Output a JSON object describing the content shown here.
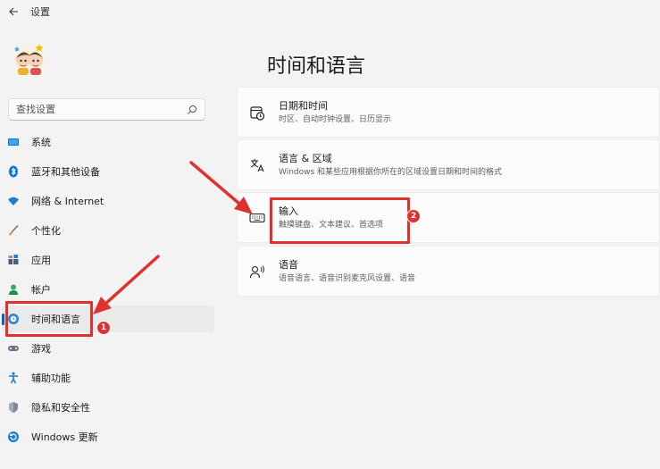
{
  "window": {
    "title": "设置"
  },
  "search": {
    "placeholder": "查找设置"
  },
  "sidebar": {
    "items": [
      {
        "label": "系统",
        "icon": "monitor-icon"
      },
      {
        "label": "蓝牙和其他设备",
        "icon": "bluetooth-icon"
      },
      {
        "label": "网络 & Internet",
        "icon": "wifi-icon"
      },
      {
        "label": "个性化",
        "icon": "brush-icon"
      },
      {
        "label": "应用",
        "icon": "apps-icon"
      },
      {
        "label": "帐户",
        "icon": "person-icon"
      },
      {
        "label": "时间和语言",
        "icon": "globe-clock-icon",
        "active": true
      },
      {
        "label": "游戏",
        "icon": "gamepad-icon"
      },
      {
        "label": "辅助功能",
        "icon": "accessibility-icon"
      },
      {
        "label": "隐私和安全性",
        "icon": "shield-icon"
      },
      {
        "label": "Windows 更新",
        "icon": "update-icon"
      }
    ]
  },
  "main": {
    "title": "时间和语言",
    "cards": [
      {
        "title": "日期和时间",
        "subtitle": "时区、自动时钟设置、日历显示",
        "icon": "calendar-clock-icon"
      },
      {
        "title": "语言 & 区域",
        "subtitle": "Windows 和某些应用根据你所在的区域设置日期和时间的格式",
        "icon": "language-icon"
      },
      {
        "title": "输入",
        "subtitle": "触摸键盘、文本建议、首选项",
        "icon": "keyboard-icon"
      },
      {
        "title": "语音",
        "subtitle": "语音语言、语音识别麦克风设置、语音",
        "icon": "speech-icon"
      }
    ]
  },
  "annotations": {
    "badge1": "1",
    "badge2": "2",
    "color": "#e0312f"
  },
  "colors": {
    "accent": "#0067c0",
    "background": "#f3f3f3",
    "card": "#fbfbfb"
  }
}
